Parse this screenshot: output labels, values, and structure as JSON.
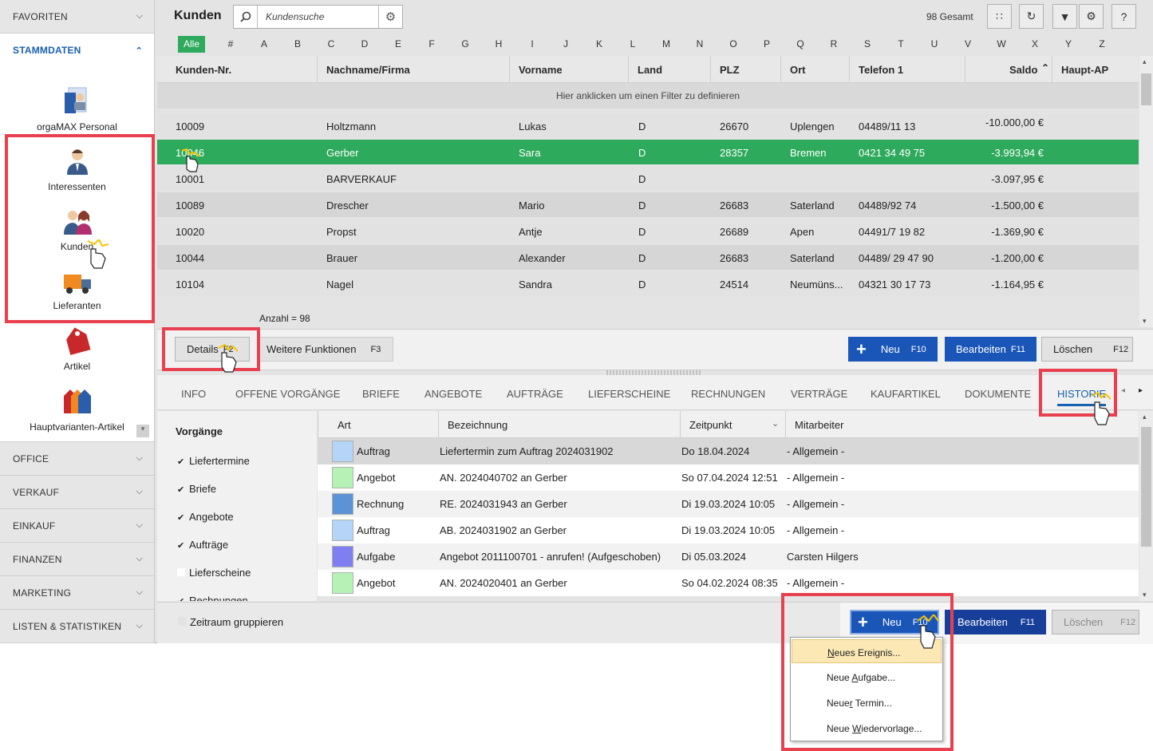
{
  "sidebar": {
    "sections_top": [
      {
        "label": "FAVORITEN"
      },
      {
        "label": "STAMMDATEN"
      }
    ],
    "items": [
      {
        "label": "orgaMAX Personal"
      },
      {
        "label": "Interessenten"
      },
      {
        "label": "Kunden"
      },
      {
        "label": "Lieferanten"
      },
      {
        "label": "Artikel"
      },
      {
        "label": "Hauptvarianten-Artikel"
      }
    ],
    "sections_bottom": [
      {
        "label": "OFFICE"
      },
      {
        "label": "VERKAUF"
      },
      {
        "label": "EINKAUF"
      },
      {
        "label": "FINANZEN"
      },
      {
        "label": "MARKETING"
      },
      {
        "label": "LISTEN & STATISTIKEN"
      }
    ]
  },
  "header": {
    "title": "Kunden",
    "search_placeholder": "Kundensuche",
    "total": "98 Gesamt"
  },
  "alphabet": [
    "Alle",
    "#",
    "A",
    "B",
    "C",
    "D",
    "E",
    "F",
    "G",
    "H",
    "I",
    "J",
    "K",
    "L",
    "M",
    "N",
    "O",
    "P",
    "Q",
    "R",
    "S",
    "T",
    "U",
    "V",
    "W",
    "X",
    "Y",
    "Z"
  ],
  "grid": {
    "columns": [
      "Kunden-Nr.",
      "Nachname/Firma",
      "Vorname",
      "Land",
      "PLZ",
      "Ort",
      "Telefon 1",
      "Saldo",
      "Haupt-AP"
    ],
    "filter_hint": "Hier anklicken um einen Filter zu definieren",
    "rows": [
      [
        "10009",
        "Holtzmann",
        "Lukas",
        "D",
        "26670",
        "Uplengen",
        "04489/11 13",
        "-10.000,00 €"
      ],
      [
        "10046",
        "Gerber",
        "Sara",
        "D",
        "28357",
        "Bremen",
        "0421 34 49 75",
        "-3.993,94 €"
      ],
      [
        "10001",
        "BARVERKAUF",
        "",
        "D",
        "",
        "",
        "",
        "-3.097,95 €"
      ],
      [
        "10089",
        "Drescher",
        "Mario",
        "D",
        "26683",
        "Saterland",
        "04489/92 74",
        "-1.500,00 €"
      ],
      [
        "10020",
        "Propst",
        "Antje",
        "D",
        "26689",
        "Apen",
        "04491/7 19 82",
        "-1.369,90 €"
      ],
      [
        "10044",
        "Brauer",
        "Alexander",
        "D",
        "26683",
        "Saterland",
        "04489/ 29 47 90",
        "-1.200,00 €"
      ],
      [
        "10104",
        "Nagel",
        "Sandra",
        "D",
        "24514",
        "Neumüns...",
        "04321 30 17 73",
        "-1.164,95 €"
      ]
    ],
    "row_display_id_2": "10",
    "row_display_id_2b": "1",
    "count": "Anzahl = 98"
  },
  "actions": {
    "details": "Details",
    "details_key": "F2",
    "weitere": "Weitere Funktionen",
    "weitere_key": "F3",
    "neu": "Neu",
    "neu_key": "F10",
    "bearbeiten": "Bearbeiten",
    "bearbeiten_key": "F11",
    "loeschen": "Löschen",
    "loeschen_key": "F12"
  },
  "tabs": [
    "INFO",
    "OFFENE VORGÄNGE",
    "BRIEFE",
    "ANGEBOTE",
    "AUFTRÄGE",
    "LIEFERSCHEINE",
    "RECHNUNGEN",
    "VERTRÄGE",
    "KAUFARTIKEL",
    "DOKUMENTE",
    "HISTORIE"
  ],
  "vorgaenge": {
    "title": "Vorgänge",
    "items": [
      {
        "label": "Liefertermine",
        "checked": true
      },
      {
        "label": "Briefe",
        "checked": true
      },
      {
        "label": "Angebote",
        "checked": true
      },
      {
        "label": "Aufträge",
        "checked": true
      },
      {
        "label": "Lieferscheine",
        "checked": false
      },
      {
        "label": "Rechnungen",
        "checked": true
      }
    ]
  },
  "history": {
    "columns": [
      "Art",
      "Bezeichnung",
      "Zeitpunkt",
      "Mitarbeiter"
    ],
    "rows": [
      {
        "art": "Auftrag",
        "color": "#b4d4f8",
        "bez": "Liefertermin zum Auftrag 2024031902",
        "zeit": "Do 18.04.2024",
        "ma": "- Allgemein -"
      },
      {
        "art": "Angebot",
        "color": "#b6f2b6",
        "bez": "AN. 2024040702 an Gerber",
        "zeit": "So 07.04.2024 12:51",
        "ma": "- Allgemein -"
      },
      {
        "art": "Rechnung",
        "color": "#5c92d6",
        "bez": "RE. 2024031943 an Gerber",
        "zeit": "Di 19.03.2024 10:05",
        "ma": "- Allgemein -"
      },
      {
        "art": "Auftrag",
        "color": "#b4d4f8",
        "bez": "AB. 2024031902 an Gerber",
        "zeit": "Di 19.03.2024 10:05",
        "ma": "- Allgemein -"
      },
      {
        "art": "Aufgabe",
        "color": "#7f7ff2",
        "bez": "Angebot 2011100701 - anrufen! (Aufgeschoben)",
        "zeit": "Di 05.03.2024",
        "ma": "Carsten Hilgers"
      },
      {
        "art": "Angebot",
        "color": "#b6f2b6",
        "bez": "AN. 2024020401 an Gerber",
        "zeit": "So 04.02.2024 08:35",
        "ma": "- Allgemein -"
      }
    ]
  },
  "bottom": {
    "zeitraum": "Zeitraum gruppieren",
    "neu": "Neu",
    "neu_key": "F10",
    "bearbeiten": "Bearbeiten",
    "bearbeiten_key": "F11",
    "loeschen": "Löschen",
    "loeschen_key": "F12"
  },
  "menu": {
    "items": [
      {
        "prefix": "",
        "hot": "N",
        "rest": "eues Ereignis..."
      },
      {
        "prefix": "Neue ",
        "hot": "A",
        "rest": "ufgabe..."
      },
      {
        "prefix": "Neue",
        "hot": "r",
        "rest": " Termin..."
      },
      {
        "prefix": "Neue ",
        "hot": "W",
        "rest": "iedervorlage..."
      }
    ]
  },
  "colors": {
    "accent_green": "#2eaa5c",
    "accent_blue": "#1a56b8",
    "highlight_red": "#e8404e",
    "tab_active": "#1860b0"
  }
}
